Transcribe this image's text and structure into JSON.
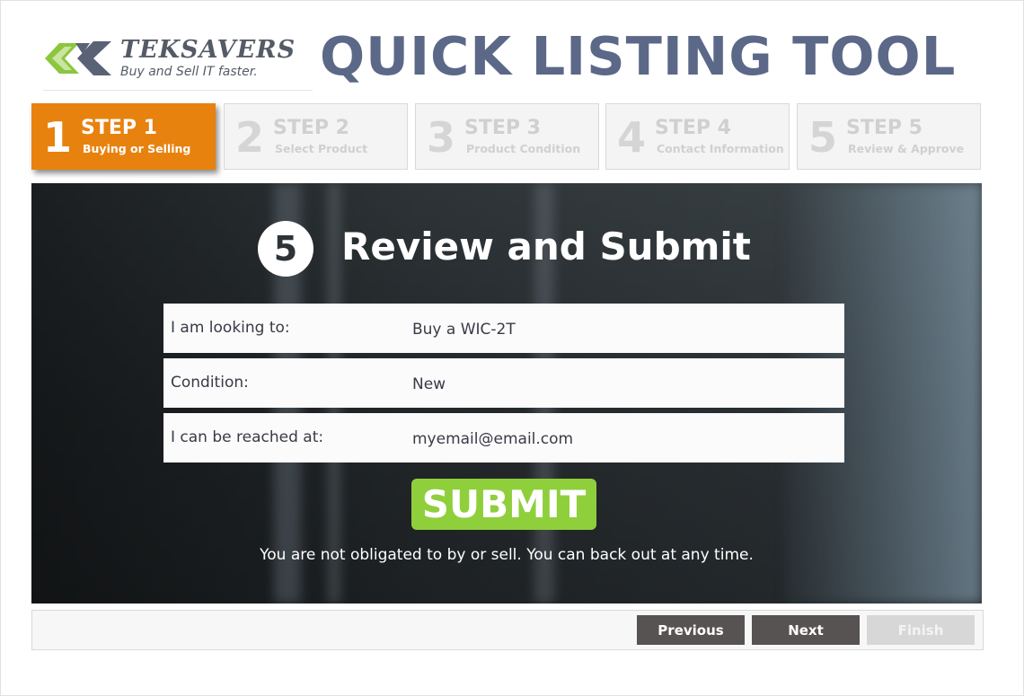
{
  "header": {
    "logo_name": "TEKSAVERS",
    "logo_tagline": "Buy and Sell IT faster.",
    "app_title": "QUICK LISTING TOOL"
  },
  "steps": [
    {
      "number": "1",
      "title": "STEP 1",
      "subtitle": "Buying or Selling",
      "active": true
    },
    {
      "number": "2",
      "title": "STEP 2",
      "subtitle": "Select Product",
      "active": false
    },
    {
      "number": "3",
      "title": "STEP 3",
      "subtitle": "Product Condition",
      "active": false
    },
    {
      "number": "4",
      "title": "STEP 4",
      "subtitle": "Contact Information",
      "active": false
    },
    {
      "number": "5",
      "title": "STEP 5",
      "subtitle": "Review & Approve",
      "active": false
    }
  ],
  "review": {
    "step_number": "5",
    "heading": "Review and Submit",
    "rows": [
      {
        "label": "I am looking to:",
        "value": "Buy a WIC-2T"
      },
      {
        "label": "Condition:",
        "value": "New"
      },
      {
        "label": "I can be reached at:",
        "value": "myemail@email.com"
      }
    ],
    "submit_label": "SUBMIT",
    "disclaimer": "You are not obligated to by or sell. You can back out at any time."
  },
  "footer": {
    "previous_label": "Previous",
    "next_label": "Next",
    "finish_label": "Finish"
  },
  "colors": {
    "active_step": "#e8820f",
    "title": "#5c6887",
    "submit": "#8fcf3c",
    "nav_button": "#575352",
    "nav_disabled": "#d7d7d7"
  }
}
